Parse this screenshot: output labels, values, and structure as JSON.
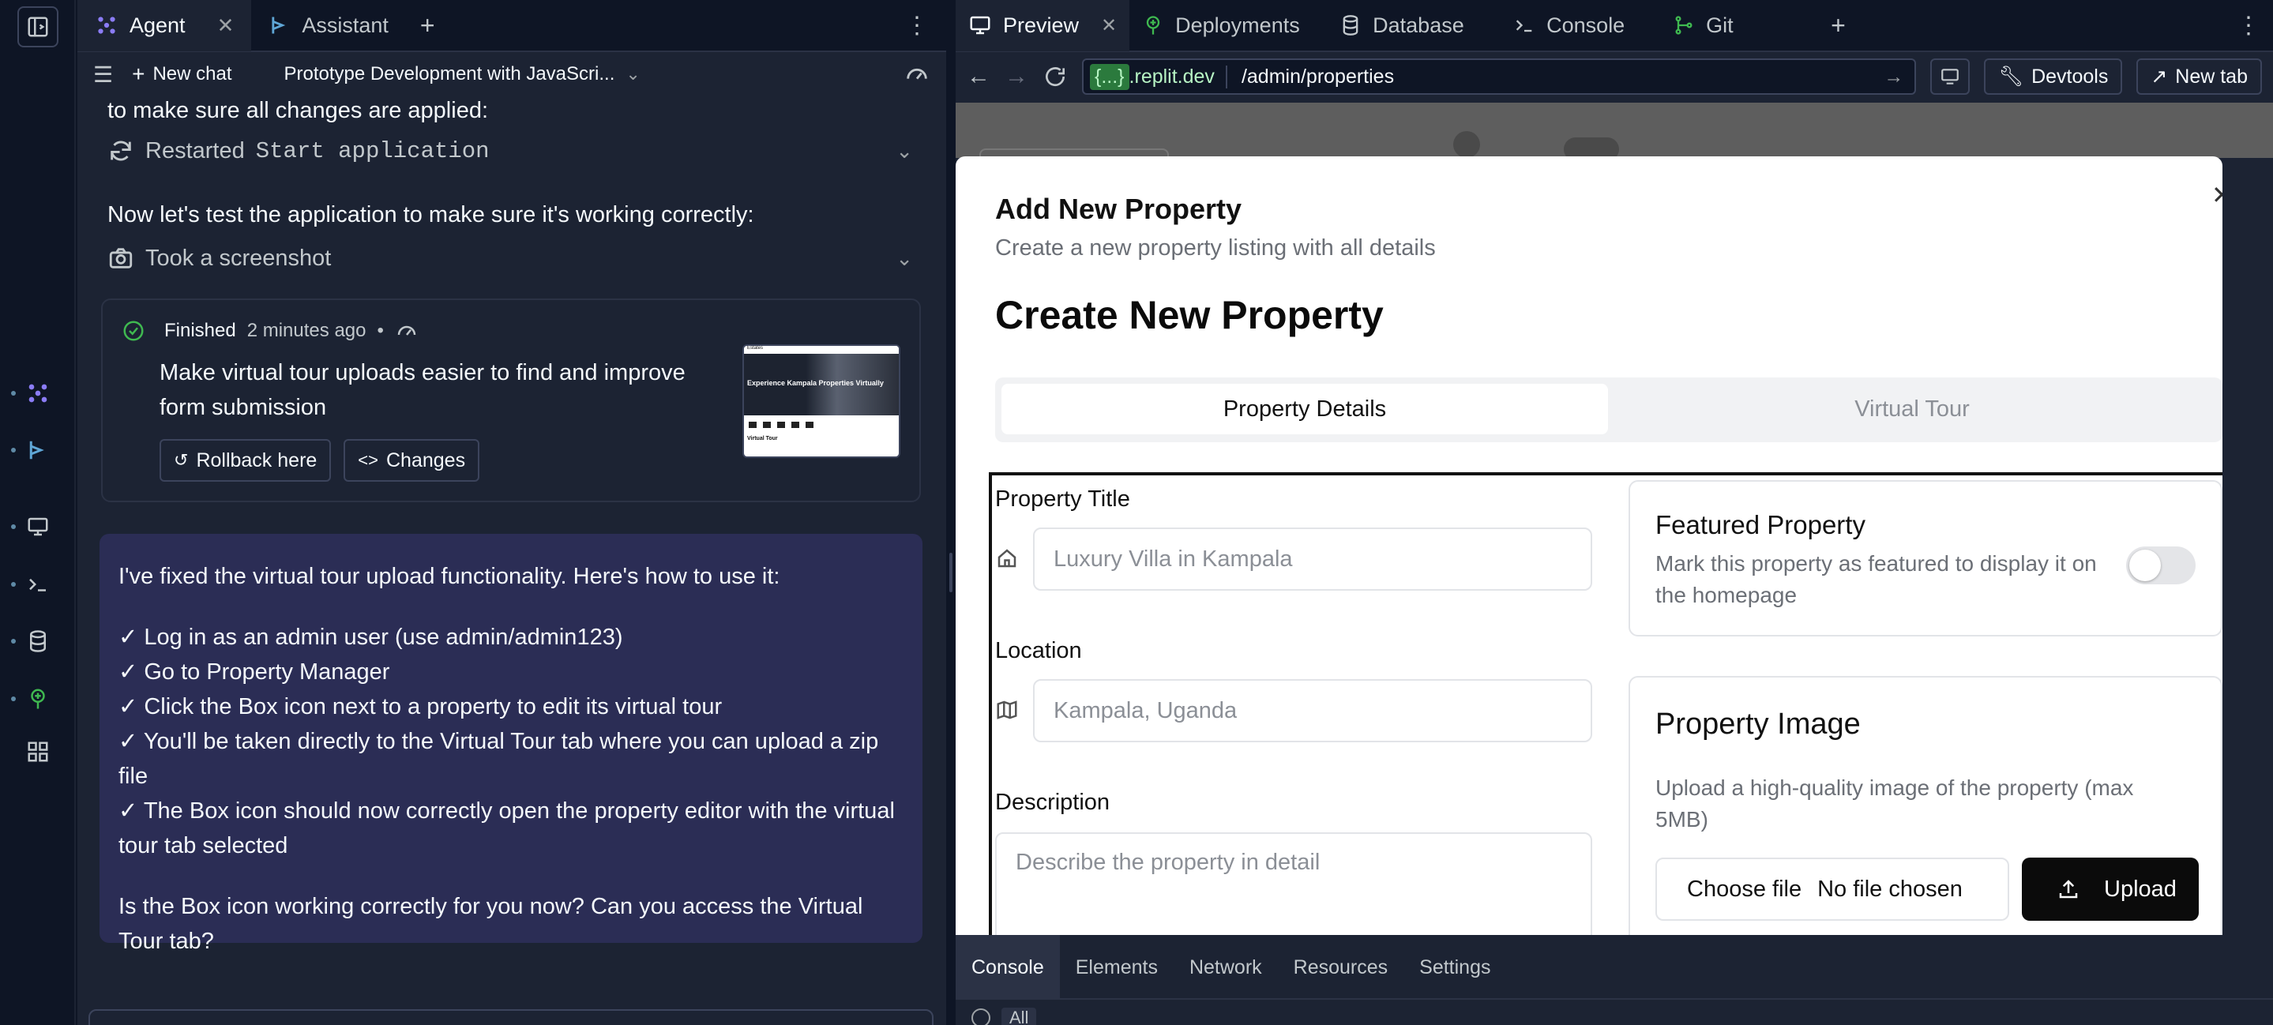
{
  "agent_tabs": {
    "agent": "Agent",
    "assistant": "Assistant"
  },
  "agent_toolbar": {
    "new_chat": "New chat",
    "chat_title": "Prototype Development with JavaScri..."
  },
  "conversation": {
    "intro_line": "to make sure all changes are applied:",
    "restarted_prefix": "Restarted",
    "restarted_target": "Start application",
    "test_line": "Now let's test the application to make sure it's working correctly:",
    "screenshot_action": "Took a screenshot"
  },
  "checkpoint": {
    "status": "Finished",
    "time": "2 minutes ago",
    "separator": "•",
    "summary": "Make virtual tour uploads easier to find and improve form submission",
    "rollback": "Rollback here",
    "changes": "Changes",
    "thumb_heading": "Experience Kampala Properties Virtually",
    "thumb_brand": "Estates",
    "thumb_footer": "Virtual Tour"
  },
  "agent_message": {
    "intro": "I've fixed the virtual tour upload functionality. Here's how to use it:",
    "steps": [
      "✓ Log in as an admin user (use admin/admin123)",
      "✓ Go to Property Manager",
      "✓ Click the Box icon next to a property to edit its virtual tour",
      "✓ You'll be taken directly to the Virtual Tour tab where you can upload a zip file",
      "✓ The Box icon should now correctly open the property editor with the virtual tour tab selected"
    ],
    "question": "Is the Box icon working correctly for you now? Can you access the Virtual Tour tab?"
  },
  "preview_tabs": {
    "preview": "Preview",
    "deployments": "Deployments",
    "database": "Database",
    "console": "Console",
    "git": "Git"
  },
  "address": {
    "domain_tag": "{...}",
    "domain": ".replit.dev",
    "path": "/admin/properties",
    "devtools": "Devtools",
    "new_tab": "New tab"
  },
  "modal": {
    "title": "Add New Property",
    "subtitle": "Create a new property listing with all details",
    "heading": "Create New Property",
    "tab_details": "Property Details",
    "tab_tour": "Virtual Tour",
    "title_label": "Property Title",
    "title_placeholder": "Luxury Villa in Kampala",
    "location_label": "Location",
    "location_placeholder": "Kampala, Uganda",
    "description_label": "Description",
    "description_placeholder": "Describe the property in detail",
    "featured_title": "Featured Property",
    "featured_desc": "Mark this property as featured to display it on the homepage",
    "featured_enabled": false,
    "image_title": "Property Image",
    "image_desc": "Upload a high-quality image of the property (max 5MB)",
    "choose_file": "Choose file",
    "no_file": "No file chosen",
    "upload": "Upload"
  },
  "devtools_tabs": [
    "Console",
    "Elements",
    "Network",
    "Resources",
    "Settings"
  ],
  "devtools_filter": "All",
  "colors": {
    "accent": "#5b7cfa",
    "agent_bubble": "#2b2d55",
    "success": "#3fb950",
    "url_highlight": "#2b7a3d"
  }
}
